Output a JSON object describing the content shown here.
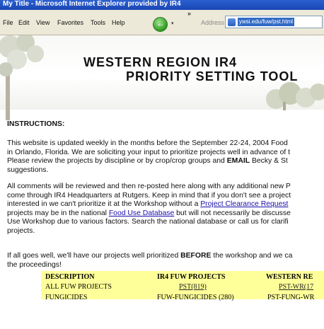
{
  "window": {
    "title": "My Title - Microsoft Internet Explorer provided by IR4"
  },
  "menu": {
    "items": [
      "File",
      "Edit",
      "View",
      "Favorites",
      "Tools",
      "Help"
    ]
  },
  "toolbar": {
    "chevron": "»",
    "back_dropdown": "▾",
    "address_label": "Address",
    "address_value": "ywsi.edu/fuw/pst.html"
  },
  "banner": {
    "line1": "WESTERN REGION IR4",
    "line2": "PRIORITY SETTING TOOL"
  },
  "instructions": {
    "heading": "INSTRUCTIONS:"
  },
  "para1": {
    "lines": [
      "This website is updated weekly in the months before the September 22-24, 2004 Food",
      "in Orlando, Florida. We are soliciting your input to prioritize projects well in advance of t",
      "Please review the projects by discipline or by crop/crop groups and "
    ],
    "bold": "EMAIL",
    "after_bold": " Becky & St",
    "line4": "suggestions."
  },
  "para2": {
    "l1": "All comments will be reviewed and then re-posted here along with any additional new P",
    "l2": "come through IR4 Headquarters at Rutgers. Keep in mind that if you don't see a project",
    "l3a": "interested in we can't prioritize it at the Workshop without a ",
    "l3link": "Project Clearance Request",
    "l4": "projects may be in the national ",
    "l4link": "Food Use Database",
    "l4b": " but will not necessarily be discusse",
    "l5": "Use Workshop due to various factors. Search the national database or call us for clarifi",
    "l6": "projects."
  },
  "para3": {
    "l1a": "If all goes well, we'll have our projects well prioritized ",
    "l1bold": "BEFORE",
    "l1b": " the workshop and we ca",
    "l2": "the proceedings!"
  },
  "table": {
    "headers": [
      "DESCRIPTION",
      "IR4 FUW PROJECTS",
      "WESTERN RE"
    ],
    "rows": [
      [
        "ALL FUW PROJECTS",
        "PST(819)",
        "PST-WR(17"
      ],
      [
        "FUNGICIDES",
        "FUW-FUNGICIDES (280)",
        "PST-FUNG-WR"
      ]
    ]
  }
}
